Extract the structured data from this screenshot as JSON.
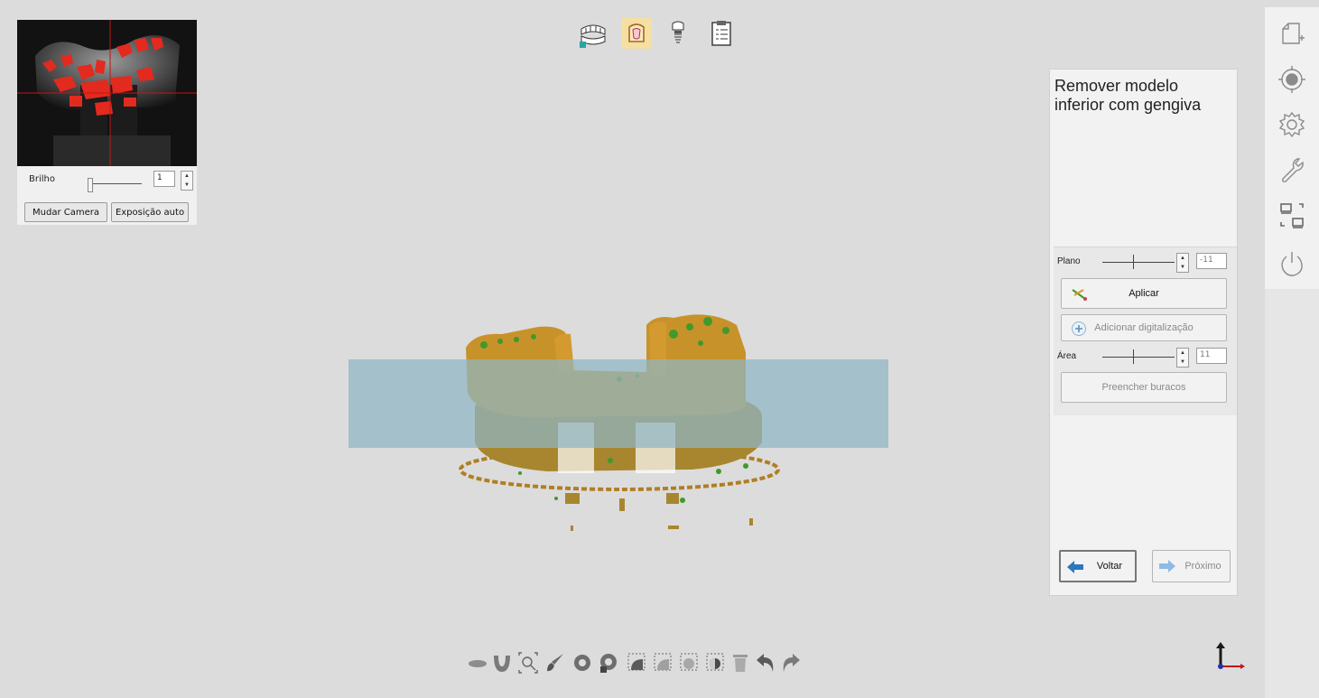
{
  "camera_panel": {
    "brightness_label": "Brilho",
    "brightness_value": "1",
    "change_camera_label": "Mudar Camera",
    "auto_exposure_label": "Exposição auto"
  },
  "top_toolbar": {
    "icons": [
      "full-arch-scan-icon",
      "single-tooth-icon",
      "implant-icon",
      "report-clipboard-icon"
    ],
    "active": "single-tooth-icon"
  },
  "right_panel": {
    "title": "Remover modelo inferior com gengiva",
    "plane_label": "Plano",
    "plane_value": "-11",
    "apply_label": "Aplicar",
    "add_scan_label": "Adicionar digitalização",
    "area_label": "Área",
    "area_value": "11",
    "fill_holes_label": "Preencher buracos",
    "back_label": "Voltar",
    "next_label": "Próximo"
  },
  "sidebar": {
    "icons": [
      "new-document-icon",
      "target-icon",
      "settings-gear-icon",
      "wrench-icon",
      "screen-switch-icon",
      "power-icon"
    ]
  },
  "bottom_toolbar": {
    "icons": [
      "lower-jaw-icon",
      "arch-icon",
      "zoom-fit-icon",
      "brush-icon",
      "rotate-select-icon",
      "deselect-icon",
      "rect-select-icon",
      "rect-deselect-icon",
      "lasso-select-icon",
      "invert-select-icon",
      "trash-icon",
      "undo-icon",
      "redo-icon"
    ]
  },
  "colors": {
    "model_gold": "#c8922a",
    "model_green": "#3f9a2a",
    "cut_plane": "#8fb6c3",
    "scan_highlight": "#e32a1f",
    "active_tool_bg": "#f6dfa3"
  }
}
